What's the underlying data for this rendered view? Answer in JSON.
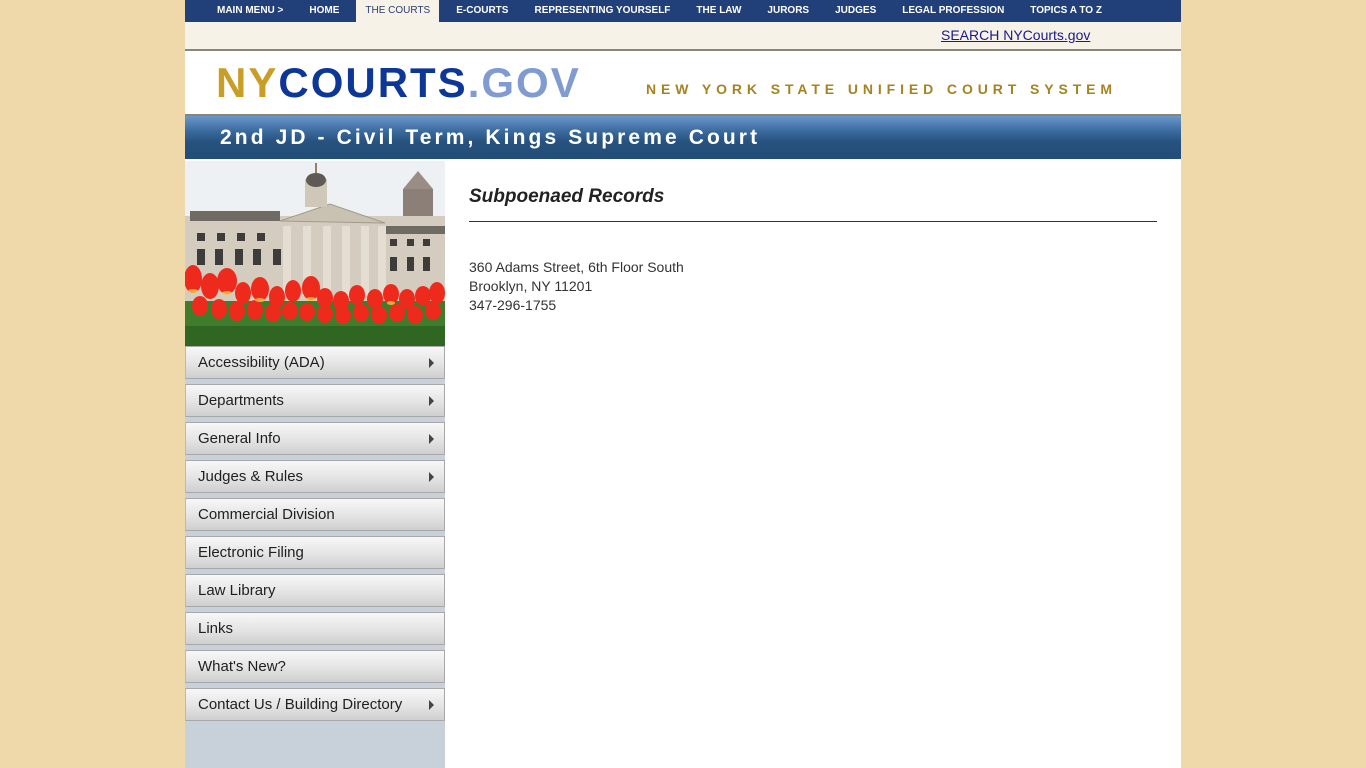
{
  "topnav": {
    "items": [
      {
        "label": "MAIN MENU >",
        "active": false
      },
      {
        "label": "HOME",
        "active": false
      },
      {
        "label": "THE COURTS",
        "active": true
      },
      {
        "label": "E-COURTS",
        "active": false
      },
      {
        "label": "REPRESENTING YOURSELF",
        "active": false
      },
      {
        "label": "THE LAW",
        "active": false
      },
      {
        "label": "JURORS",
        "active": false
      },
      {
        "label": "JUDGES",
        "active": false
      },
      {
        "label": "LEGAL PROFESSION",
        "active": false
      },
      {
        "label": "TOPICS A TO Z",
        "active": false
      }
    ]
  },
  "search": {
    "link_label": "SEARCH NYCourts.gov"
  },
  "logo": {
    "ny": "NY",
    "courts": "COURTS",
    "gov": ".GOV",
    "tagline": "NEW YORK STATE UNIFIED COURT SYSTEM"
  },
  "banner": {
    "title": "2nd JD - Civil Term, Kings Supreme Court"
  },
  "sidebar": {
    "photo_alt": "Brooklyn Borough Hall with red tulips",
    "items": [
      {
        "label": "Accessibility (ADA)",
        "has_submenu": true
      },
      {
        "label": "Departments",
        "has_submenu": true
      },
      {
        "label": "General Info",
        "has_submenu": true
      },
      {
        "label": "Judges & Rules",
        "has_submenu": true
      },
      {
        "label": "Commercial Division",
        "has_submenu": false
      },
      {
        "label": "Electronic Filing",
        "has_submenu": false
      },
      {
        "label": "Law Library",
        "has_submenu": false
      },
      {
        "label": "Links",
        "has_submenu": false
      },
      {
        "label": "What's New?",
        "has_submenu": false
      },
      {
        "label": "Contact Us / Building Directory",
        "has_submenu": true
      }
    ]
  },
  "main": {
    "heading": "Subpoenaed Records",
    "address_lines": [
      "360 Adams Street, 6th Floor South",
      "Brooklyn, NY 11201",
      "347-296-1755"
    ]
  },
  "colors": {
    "nav_bg": "#21407a",
    "page_bg": "#efd9aa",
    "logo_ny": "#c99e27",
    "logo_courts": "#0d3797",
    "logo_gov": "#7f9bd1",
    "tagline": "#a6831f",
    "banner": "#27527f"
  }
}
